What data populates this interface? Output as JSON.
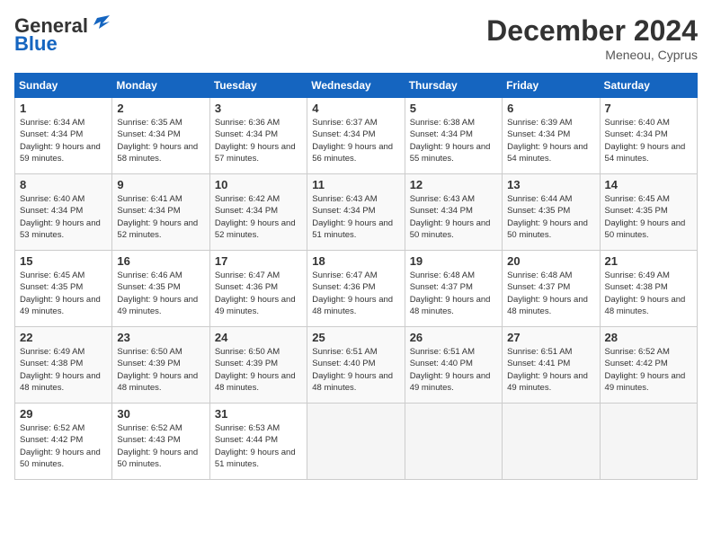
{
  "header": {
    "logo_line1": "General",
    "logo_line2": "Blue",
    "month_title": "December 2024",
    "location": "Meneou, Cyprus"
  },
  "days_of_week": [
    "Sunday",
    "Monday",
    "Tuesday",
    "Wednesday",
    "Thursday",
    "Friday",
    "Saturday"
  ],
  "weeks": [
    [
      {
        "day": 1,
        "sunrise": "6:34 AM",
        "sunset": "4:34 PM",
        "daylight": "9 hours and 59 minutes."
      },
      {
        "day": 2,
        "sunrise": "6:35 AM",
        "sunset": "4:34 PM",
        "daylight": "9 hours and 58 minutes."
      },
      {
        "day": 3,
        "sunrise": "6:36 AM",
        "sunset": "4:34 PM",
        "daylight": "9 hours and 57 minutes."
      },
      {
        "day": 4,
        "sunrise": "6:37 AM",
        "sunset": "4:34 PM",
        "daylight": "9 hours and 56 minutes."
      },
      {
        "day": 5,
        "sunrise": "6:38 AM",
        "sunset": "4:34 PM",
        "daylight": "9 hours and 55 minutes."
      },
      {
        "day": 6,
        "sunrise": "6:39 AM",
        "sunset": "4:34 PM",
        "daylight": "9 hours and 54 minutes."
      },
      {
        "day": 7,
        "sunrise": "6:40 AM",
        "sunset": "4:34 PM",
        "daylight": "9 hours and 54 minutes."
      }
    ],
    [
      {
        "day": 8,
        "sunrise": "6:40 AM",
        "sunset": "4:34 PM",
        "daylight": "9 hours and 53 minutes."
      },
      {
        "day": 9,
        "sunrise": "6:41 AM",
        "sunset": "4:34 PM",
        "daylight": "9 hours and 52 minutes."
      },
      {
        "day": 10,
        "sunrise": "6:42 AM",
        "sunset": "4:34 PM",
        "daylight": "9 hours and 52 minutes."
      },
      {
        "day": 11,
        "sunrise": "6:43 AM",
        "sunset": "4:34 PM",
        "daylight": "9 hours and 51 minutes."
      },
      {
        "day": 12,
        "sunrise": "6:43 AM",
        "sunset": "4:34 PM",
        "daylight": "9 hours and 50 minutes."
      },
      {
        "day": 13,
        "sunrise": "6:44 AM",
        "sunset": "4:35 PM",
        "daylight": "9 hours and 50 minutes."
      },
      {
        "day": 14,
        "sunrise": "6:45 AM",
        "sunset": "4:35 PM",
        "daylight": "9 hours and 50 minutes."
      }
    ],
    [
      {
        "day": 15,
        "sunrise": "6:45 AM",
        "sunset": "4:35 PM",
        "daylight": "9 hours and 49 minutes."
      },
      {
        "day": 16,
        "sunrise": "6:46 AM",
        "sunset": "4:35 PM",
        "daylight": "9 hours and 49 minutes."
      },
      {
        "day": 17,
        "sunrise": "6:47 AM",
        "sunset": "4:36 PM",
        "daylight": "9 hours and 49 minutes."
      },
      {
        "day": 18,
        "sunrise": "6:47 AM",
        "sunset": "4:36 PM",
        "daylight": "9 hours and 48 minutes."
      },
      {
        "day": 19,
        "sunrise": "6:48 AM",
        "sunset": "4:37 PM",
        "daylight": "9 hours and 48 minutes."
      },
      {
        "day": 20,
        "sunrise": "6:48 AM",
        "sunset": "4:37 PM",
        "daylight": "9 hours and 48 minutes."
      },
      {
        "day": 21,
        "sunrise": "6:49 AM",
        "sunset": "4:38 PM",
        "daylight": "9 hours and 48 minutes."
      }
    ],
    [
      {
        "day": 22,
        "sunrise": "6:49 AM",
        "sunset": "4:38 PM",
        "daylight": "9 hours and 48 minutes."
      },
      {
        "day": 23,
        "sunrise": "6:50 AM",
        "sunset": "4:39 PM",
        "daylight": "9 hours and 48 minutes."
      },
      {
        "day": 24,
        "sunrise": "6:50 AM",
        "sunset": "4:39 PM",
        "daylight": "9 hours and 48 minutes."
      },
      {
        "day": 25,
        "sunrise": "6:51 AM",
        "sunset": "4:40 PM",
        "daylight": "9 hours and 48 minutes."
      },
      {
        "day": 26,
        "sunrise": "6:51 AM",
        "sunset": "4:40 PM",
        "daylight": "9 hours and 49 minutes."
      },
      {
        "day": 27,
        "sunrise": "6:51 AM",
        "sunset": "4:41 PM",
        "daylight": "9 hours and 49 minutes."
      },
      {
        "day": 28,
        "sunrise": "6:52 AM",
        "sunset": "4:42 PM",
        "daylight": "9 hours and 49 minutes."
      }
    ],
    [
      {
        "day": 29,
        "sunrise": "6:52 AM",
        "sunset": "4:42 PM",
        "daylight": "9 hours and 50 minutes."
      },
      {
        "day": 30,
        "sunrise": "6:52 AM",
        "sunset": "4:43 PM",
        "daylight": "9 hours and 50 minutes."
      },
      {
        "day": 31,
        "sunrise": "6:53 AM",
        "sunset": "4:44 PM",
        "daylight": "9 hours and 51 minutes."
      },
      null,
      null,
      null,
      null
    ]
  ]
}
